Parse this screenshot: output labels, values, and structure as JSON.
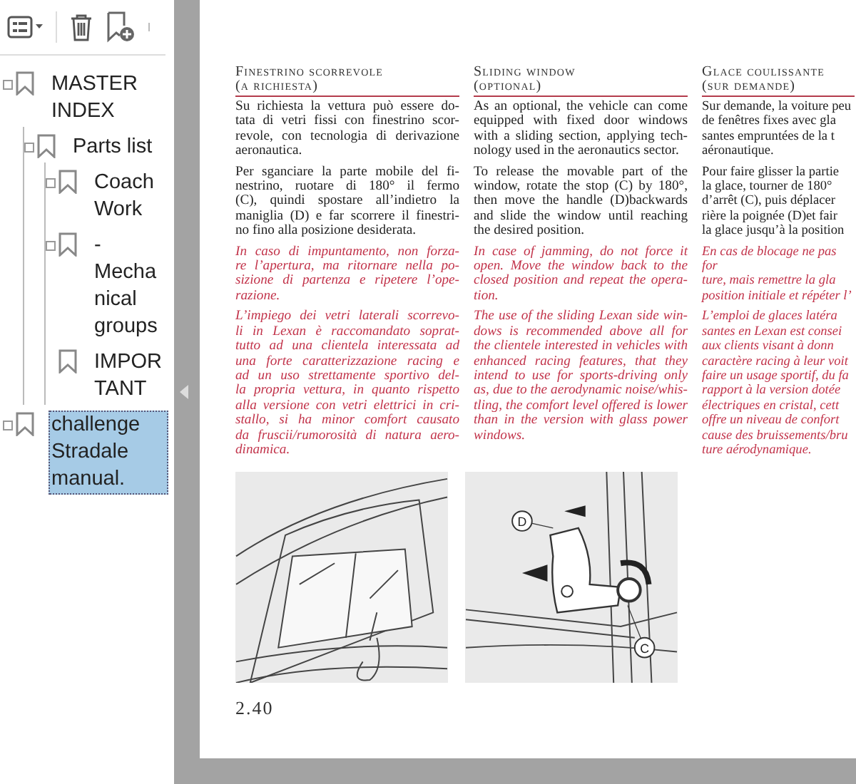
{
  "bookmarks": [
    {
      "label": "MASTER INDEX",
      "expander": true,
      "selected": false,
      "children": [
        {
          "label": "Parts list",
          "expander": true,
          "selected": false,
          "children": [
            {
              "label": "Coach Work",
              "expander": true,
              "selected": false
            },
            {
              "label": "-Mechanical groups",
              "expander": true,
              "selected": false
            },
            {
              "label": "IMPORTANT",
              "expander": false,
              "selected": false
            }
          ]
        }
      ]
    },
    {
      "label": "challenge Stradale manual.",
      "expander": true,
      "selected": true
    }
  ],
  "page": {
    "columns": [
      {
        "heading": [
          "Finestrino scorrevole",
          "(a richiesta)"
        ],
        "paragraphs": [
          {
            "kind": "body",
            "lines": [
              "Su richiesta la vettura può essere do-",
              "tata di vetri fissi con finestrino scor-",
              "revole, con tecnologia di derivazione",
              "aeronautica."
            ]
          },
          {
            "kind": "body",
            "lines": [
              "Per sganciare la parte mobile del fi-",
              "nestrino, ruotare di 180° il fermo",
              "(C), quindi spostare all’indietro la",
              "maniglia (D) e far scorrere il finestri-",
              "no fino alla posizione desiderata."
            ]
          },
          {
            "kind": "note",
            "lines": [
              "In caso di impuntamento, non forza-",
              "re l’apertura, ma ritornare nella po-",
              "sizione di partenza e ripetere l’ope-",
              "razione."
            ]
          },
          {
            "kind": "note",
            "lines": [
              "L’impiego dei vetri laterali scorrevo-",
              "li in Lexan è raccomandato soprat-",
              "tutto ad una clientela interessata ad",
              "una forte caratterizzazione racing e",
              "ad un uso strettamente sportivo del-",
              "la propria vettura, in quanto rispetto",
              "alla versione con vetri elettrici in cri-",
              "stallo, si ha minor comfort causato",
              "da fruscii/rumorosità di natura aero-",
              "dinamica."
            ]
          }
        ]
      },
      {
        "heading": [
          "Sliding window",
          "(optional)"
        ],
        "paragraphs": [
          {
            "kind": "body",
            "lines": [
              "As an optional, the vehicle can come",
              "equipped with fixed door windows",
              "with a sliding section, applying tech-",
              "nology used in the aeronautics sector."
            ]
          },
          {
            "kind": "body",
            "lines": [
              "To release the movable part of the",
              "window, rotate the stop (C) by 180°,",
              "then move  the handle (D)backwards",
              "and slide the window until reaching",
              "the desired position."
            ]
          },
          {
            "kind": "note",
            "lines": [
              "In case of jamming, do not force it",
              "open. Move the window back to the",
              "closed position and repeat the opera-",
              "tion."
            ]
          },
          {
            "kind": "note",
            "lines": [
              "The use of the sliding Lexan side win-",
              "dows is recommended above all for",
              "the clientele interested in vehicles with",
              "enhanced racing features, that they",
              "intend to use for sports-driving only",
              "as, due to the aerodynamic noise/whis-",
              "tling, the comfort level offered is lower",
              "than in the version with glass power",
              "windows."
            ]
          }
        ]
      },
      {
        "heading": [
          "Glace coulissante",
          "(sur demande)"
        ],
        "paragraphs": [
          {
            "kind": "body",
            "lines": [
              "Sur demande, la voiture peu",
              "de fenêtres fixes avec gla",
              "santes empruntées de la t",
              "aéronautique."
            ]
          },
          {
            "kind": "body",
            "lines": [
              "Pour faire glisser la partie",
              "la glace, tourner de 180°",
              "d’arrêt (C), puis déplacer",
              "rière la poignée (D)et fair",
              "la glace jusqu’à la position"
            ]
          },
          {
            "kind": "note",
            "lines": [
              "En cas de blocage ne pas for",
              "ture, mais remettre la gla",
              "position initiale et répéter l’"
            ]
          },
          {
            "kind": "note",
            "lines": [
              "L’emploi de glaces latéra",
              "santes en Lexan est consei",
              "aux clients visant à donn",
              "caractère racing à leur voit",
              "faire un usage sportif, du fa",
              "rapport à la version dotée",
              "électriques en cristal, cett",
              "offre un niveau de confort",
              "cause des bruissements/bru",
              "ture aérodynamique."
            ]
          }
        ]
      }
    ],
    "figures": [
      {
        "kind": "window"
      },
      {
        "kind": "handle",
        "callouts": [
          "D",
          "C"
        ]
      }
    ],
    "page_number": "2.40"
  }
}
